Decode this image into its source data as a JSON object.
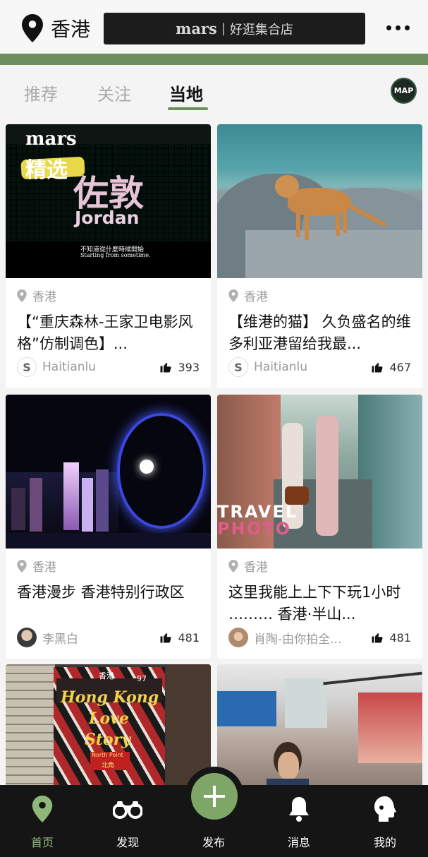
{
  "header": {
    "location": "香港",
    "banner_brand": "mars",
    "banner_sep": "|",
    "banner_sub": "好逛集合店"
  },
  "tabs": [
    {
      "label": "推荐"
    },
    {
      "label": "关注"
    },
    {
      "label": "当地"
    }
  ],
  "map_button": "MAP",
  "image_texts": {
    "mars": "mars",
    "jingxuan": "精选",
    "zuodun": "佐敦",
    "jordan": "Jordan",
    "caption1": "不知道從什麼時候開始",
    "caption2": "Starting from sometime.",
    "travel": "TRAVEL",
    "photo": "PHOTO",
    "tram_hk": "Hong Kong",
    "tram_love": "Love",
    "tram_story": "Story",
    "tram_top": "香港",
    "tram_num": "97",
    "tram_dest": "North Point",
    "tram_dest_cn": "北角"
  },
  "cards": [
    {
      "location": "香港",
      "title": "【“重庆森林-王家卫电影风格”仿制调色】...",
      "author": "Haitianlu",
      "likes": "393"
    },
    {
      "location": "香港",
      "title": "【维港的猫】 久负盛名的维多利亚港留给我最...",
      "author": "Haitianlu",
      "likes": "467"
    },
    {
      "location": "香港",
      "title": "香港漫步 香港特别行政区",
      "author": "李黑白",
      "likes": "481"
    },
    {
      "location": "香港",
      "title": "这里我能上上下下玩1小时  ………  香港·半山...",
      "author": "肖陶-由你拍全...",
      "likes": "481"
    }
  ],
  "nav": [
    {
      "label": "首页"
    },
    {
      "label": "发现"
    },
    {
      "label": "发布"
    },
    {
      "label": "消息"
    },
    {
      "label": "我的"
    }
  ],
  "colors": {
    "accent": "#6d8f5c",
    "fab": "#7ea767",
    "nav_bg": "#151515",
    "active_nav": "#8fb77a"
  }
}
